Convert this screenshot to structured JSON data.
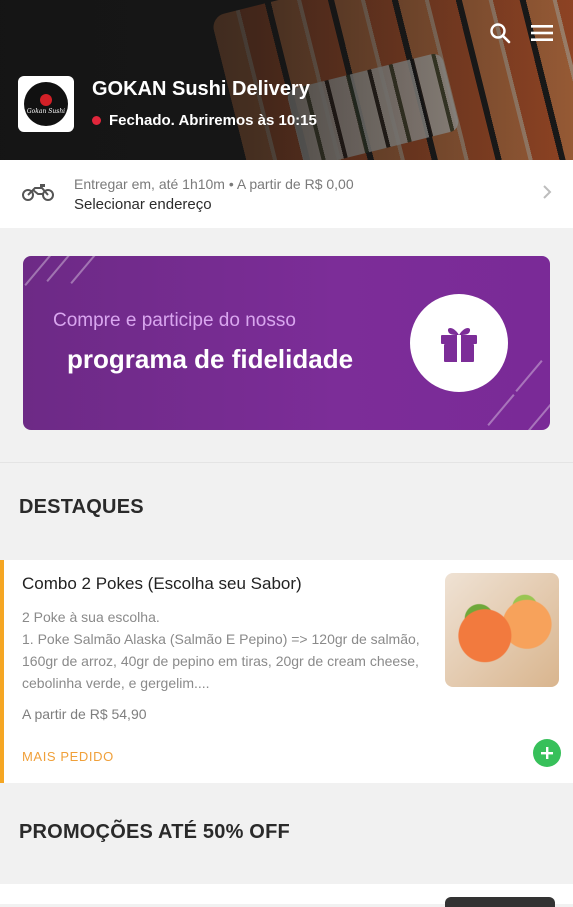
{
  "header": {
    "store_name": "GOKAN Sushi Delivery",
    "status": "Fechado. Abriremos às 10:15",
    "logo_text": "Gokan Sushi",
    "status_color": "#e0263b"
  },
  "delivery": {
    "info": "Entregar em, até 1h10m • A partir de R$ 0,00",
    "address_label": "Selecionar endereço"
  },
  "banner": {
    "line1": "Compre e participe do nosso",
    "line2": "programa de fidelidade",
    "color": "#7c2d98"
  },
  "sections": {
    "highlights_title": "DESTAQUES",
    "promos_title": "PROMOÇÕES ATÉ 50% OFF"
  },
  "product": {
    "title": "Combo 2 Pokes (Escolha seu Sabor)",
    "description": "2 Poke à sua escolha.\n1. Poke Salmão Alaska (Salmão E Pepino) => 120gr de salmão, 160gr de arroz, 40gr de pepino em tiras, 20gr de cream cheese, cebolinha verde, e gergelim....",
    "price": "A partir de R$ 54,90",
    "badge": "MAIS PEDIDO",
    "badge_color": "#f0a03a",
    "add_color": "#37c05a"
  },
  "icons": {
    "search": "search-icon",
    "menu": "menu-icon",
    "motorcycle": "motorcycle-icon",
    "chevron": "chevron-right-icon",
    "gift": "gift-icon",
    "add": "plus-icon"
  }
}
